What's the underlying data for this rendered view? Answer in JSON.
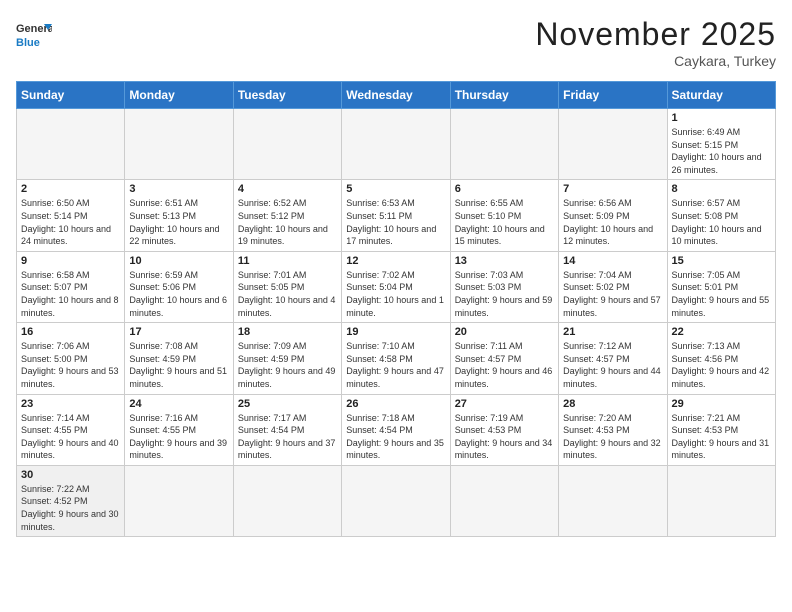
{
  "header": {
    "logo_general": "General",
    "logo_blue": "Blue",
    "month_title": "November 2025",
    "location": "Caykara, Turkey"
  },
  "weekdays": [
    "Sunday",
    "Monday",
    "Tuesday",
    "Wednesday",
    "Thursday",
    "Friday",
    "Saturday"
  ],
  "weeks": [
    [
      {
        "day": "",
        "info": ""
      },
      {
        "day": "",
        "info": ""
      },
      {
        "day": "",
        "info": ""
      },
      {
        "day": "",
        "info": ""
      },
      {
        "day": "",
        "info": ""
      },
      {
        "day": "",
        "info": ""
      },
      {
        "day": "1",
        "info": "Sunrise: 6:49 AM\nSunset: 5:15 PM\nDaylight: 10 hours and 26 minutes."
      }
    ],
    [
      {
        "day": "2",
        "info": "Sunrise: 6:50 AM\nSunset: 5:14 PM\nDaylight: 10 hours and 24 minutes."
      },
      {
        "day": "3",
        "info": "Sunrise: 6:51 AM\nSunset: 5:13 PM\nDaylight: 10 hours and 22 minutes."
      },
      {
        "day": "4",
        "info": "Sunrise: 6:52 AM\nSunset: 5:12 PM\nDaylight: 10 hours and 19 minutes."
      },
      {
        "day": "5",
        "info": "Sunrise: 6:53 AM\nSunset: 5:11 PM\nDaylight: 10 hours and 17 minutes."
      },
      {
        "day": "6",
        "info": "Sunrise: 6:55 AM\nSunset: 5:10 PM\nDaylight: 10 hours and 15 minutes."
      },
      {
        "day": "7",
        "info": "Sunrise: 6:56 AM\nSunset: 5:09 PM\nDaylight: 10 hours and 12 minutes."
      },
      {
        "day": "8",
        "info": "Sunrise: 6:57 AM\nSunset: 5:08 PM\nDaylight: 10 hours and 10 minutes."
      }
    ],
    [
      {
        "day": "9",
        "info": "Sunrise: 6:58 AM\nSunset: 5:07 PM\nDaylight: 10 hours and 8 minutes."
      },
      {
        "day": "10",
        "info": "Sunrise: 6:59 AM\nSunset: 5:06 PM\nDaylight: 10 hours and 6 minutes."
      },
      {
        "day": "11",
        "info": "Sunrise: 7:01 AM\nSunset: 5:05 PM\nDaylight: 10 hours and 4 minutes."
      },
      {
        "day": "12",
        "info": "Sunrise: 7:02 AM\nSunset: 5:04 PM\nDaylight: 10 hours and 1 minute."
      },
      {
        "day": "13",
        "info": "Sunrise: 7:03 AM\nSunset: 5:03 PM\nDaylight: 9 hours and 59 minutes."
      },
      {
        "day": "14",
        "info": "Sunrise: 7:04 AM\nSunset: 5:02 PM\nDaylight: 9 hours and 57 minutes."
      },
      {
        "day": "15",
        "info": "Sunrise: 7:05 AM\nSunset: 5:01 PM\nDaylight: 9 hours and 55 minutes."
      }
    ],
    [
      {
        "day": "16",
        "info": "Sunrise: 7:06 AM\nSunset: 5:00 PM\nDaylight: 9 hours and 53 minutes."
      },
      {
        "day": "17",
        "info": "Sunrise: 7:08 AM\nSunset: 4:59 PM\nDaylight: 9 hours and 51 minutes."
      },
      {
        "day": "18",
        "info": "Sunrise: 7:09 AM\nSunset: 4:59 PM\nDaylight: 9 hours and 49 minutes."
      },
      {
        "day": "19",
        "info": "Sunrise: 7:10 AM\nSunset: 4:58 PM\nDaylight: 9 hours and 47 minutes."
      },
      {
        "day": "20",
        "info": "Sunrise: 7:11 AM\nSunset: 4:57 PM\nDaylight: 9 hours and 46 minutes."
      },
      {
        "day": "21",
        "info": "Sunrise: 7:12 AM\nSunset: 4:57 PM\nDaylight: 9 hours and 44 minutes."
      },
      {
        "day": "22",
        "info": "Sunrise: 7:13 AM\nSunset: 4:56 PM\nDaylight: 9 hours and 42 minutes."
      }
    ],
    [
      {
        "day": "23",
        "info": "Sunrise: 7:14 AM\nSunset: 4:55 PM\nDaylight: 9 hours and 40 minutes."
      },
      {
        "day": "24",
        "info": "Sunrise: 7:16 AM\nSunset: 4:55 PM\nDaylight: 9 hours and 39 minutes."
      },
      {
        "day": "25",
        "info": "Sunrise: 7:17 AM\nSunset: 4:54 PM\nDaylight: 9 hours and 37 minutes."
      },
      {
        "day": "26",
        "info": "Sunrise: 7:18 AM\nSunset: 4:54 PM\nDaylight: 9 hours and 35 minutes."
      },
      {
        "day": "27",
        "info": "Sunrise: 7:19 AM\nSunset: 4:53 PM\nDaylight: 9 hours and 34 minutes."
      },
      {
        "day": "28",
        "info": "Sunrise: 7:20 AM\nSunset: 4:53 PM\nDaylight: 9 hours and 32 minutes."
      },
      {
        "day": "29",
        "info": "Sunrise: 7:21 AM\nSunset: 4:53 PM\nDaylight: 9 hours and 31 minutes."
      }
    ],
    [
      {
        "day": "30",
        "info": "Sunrise: 7:22 AM\nSunset: 4:52 PM\nDaylight: 9 hours and 30 minutes."
      },
      {
        "day": "",
        "info": ""
      },
      {
        "day": "",
        "info": ""
      },
      {
        "day": "",
        "info": ""
      },
      {
        "day": "",
        "info": ""
      },
      {
        "day": "",
        "info": ""
      },
      {
        "day": "",
        "info": ""
      }
    ]
  ]
}
